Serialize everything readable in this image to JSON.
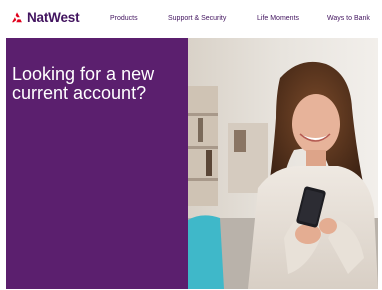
{
  "header": {
    "brand": "NatWest",
    "brand_color": "#42145f",
    "logo_mark_color": "#e0001b",
    "nav": [
      {
        "label": "Products"
      },
      {
        "label": "Support & Security"
      },
      {
        "label": "Life Moments"
      },
      {
        "label": "Ways to Bank"
      }
    ]
  },
  "hero": {
    "title_line1": "Looking for a new",
    "title_line2": "current account?",
    "panel_color": "#5b1f6e",
    "photo_subject": "smiling woman using smartphone on sofa"
  }
}
